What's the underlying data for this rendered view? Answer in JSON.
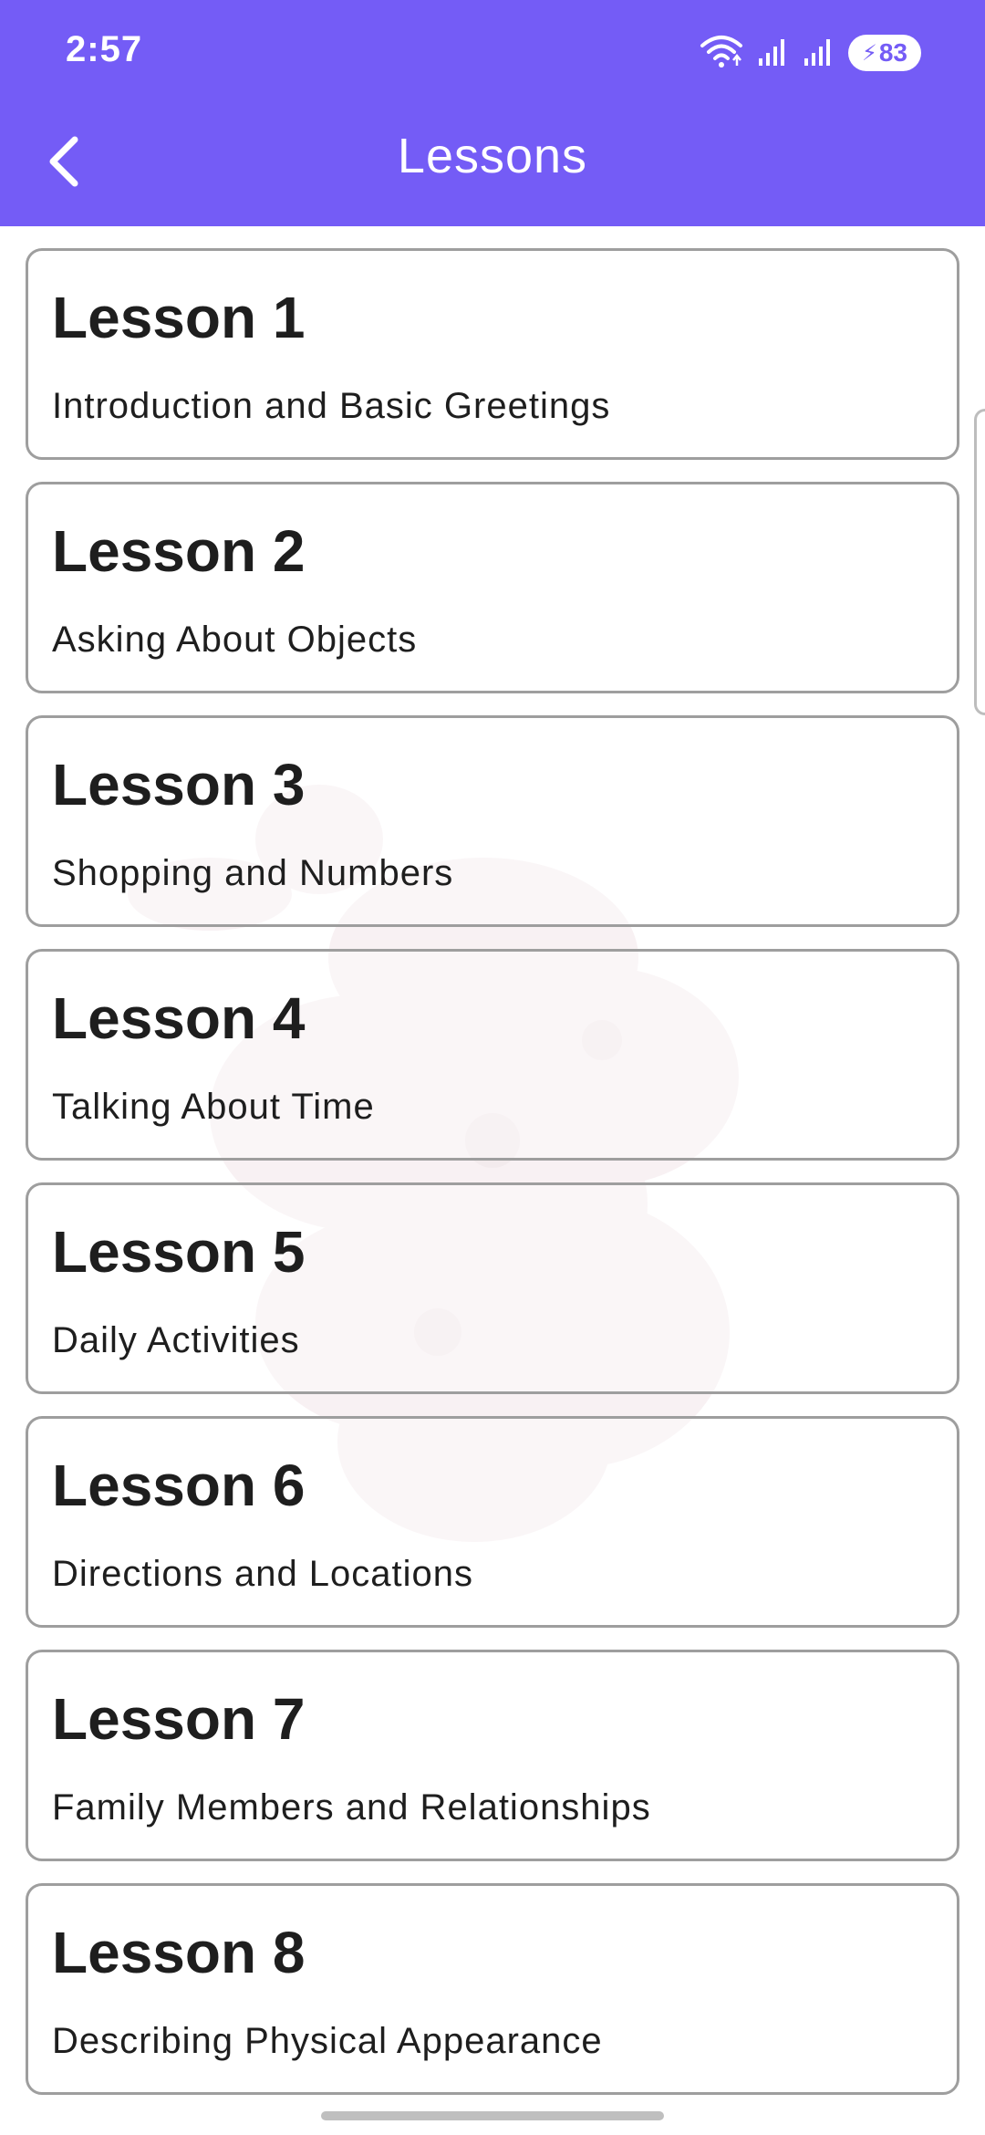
{
  "status_bar": {
    "time": "2:57",
    "battery_level": "83",
    "icons": [
      "wifi-icon",
      "signal-icon",
      "signal-icon",
      "battery-charging-icon"
    ]
  },
  "app_bar": {
    "title": "Lessons",
    "back_icon": "chevron-left-icon"
  },
  "colors": {
    "accent": "#745cf6",
    "card_border": "#9e9e9e",
    "text": "#1e1e1e"
  },
  "lessons": [
    {
      "title": "Lesson 1",
      "subtitle": "Introduction and Basic Greetings"
    },
    {
      "title": "Lesson 2",
      "subtitle": "Asking About Objects"
    },
    {
      "title": "Lesson 3",
      "subtitle": "Shopping and Numbers"
    },
    {
      "title": "Lesson 4",
      "subtitle": "Talking About Time"
    },
    {
      "title": "Lesson 5",
      "subtitle": "Daily Activities"
    },
    {
      "title": "Lesson 6",
      "subtitle": "Directions and Locations"
    },
    {
      "title": "Lesson 7",
      "subtitle": "Family Members and Relationships"
    },
    {
      "title": "Lesson 8",
      "subtitle": "Describing Physical Appearance"
    }
  ]
}
